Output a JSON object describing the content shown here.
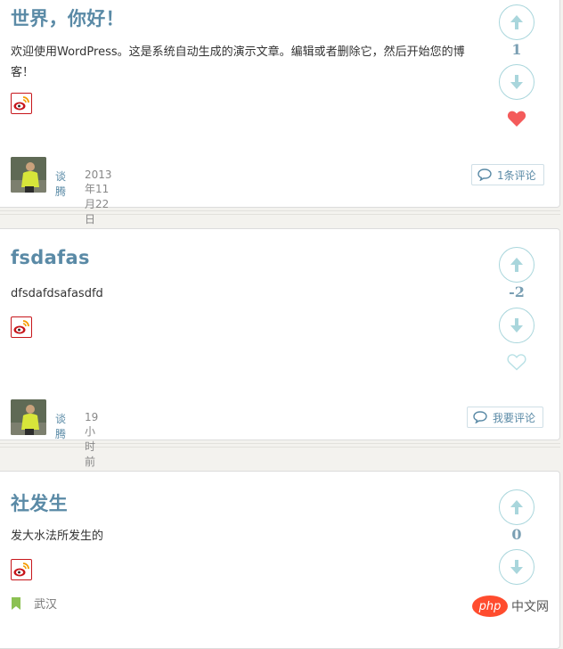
{
  "posts": [
    {
      "title": "世界，你好！",
      "excerpt": "欢迎使用WordPress。这是系统自动生成的演示文章。编辑或者删除它，然后开始您的博客！",
      "author": "谈腾",
      "date": "2013年11月22日",
      "comment_label": "1条评论",
      "score": "1",
      "liked": true
    },
    {
      "title": "fsdafas",
      "excerpt": "dfsdafdsafasdfd",
      "author": "谈腾",
      "date": "19小时前",
      "comment_label": "我要评论",
      "score": "-2",
      "liked": false
    },
    {
      "title": "社发生",
      "excerpt": "发大水法所发生的",
      "location": "武汉",
      "score": "0",
      "liked": false
    }
  ],
  "colors": {
    "title": "#5a8aa6",
    "vote_border": "#a9d6dc",
    "heart_active": "#f45b5b",
    "heart_inactive": "#b7e0e5",
    "weibo_red": "#c7161b"
  },
  "watermark": {
    "logo": "php",
    "text": "中文网"
  }
}
